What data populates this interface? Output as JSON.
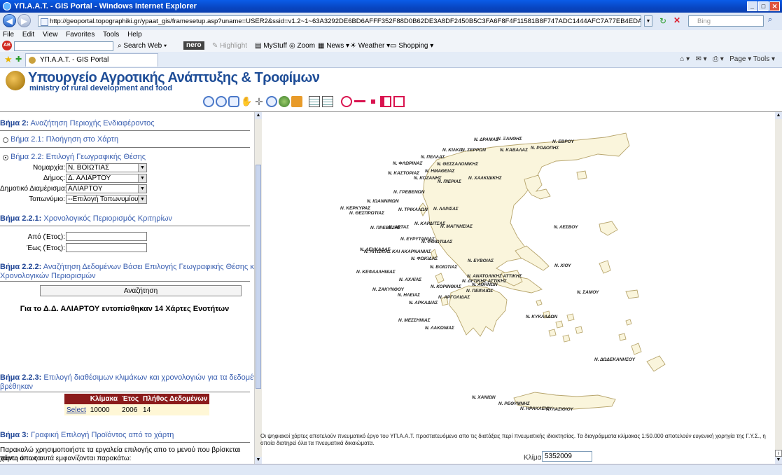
{
  "window": {
    "title": "ΥΠ.Α.Α.Τ. - GIS Portal - Windows Internet Explorer"
  },
  "browser": {
    "url": "http://geoportal.topographiki.gr/ypaat_gis/framesetup.asp?uname=USER2&ssid=v1.2~1~63A3292DE6BD6AFFF352F88D0B62DE3A8DF2450B5C3FA6F8F4F11581B8F747ADC1444AFC7A77EB4EDA496CCD72E9D7766FE09210B8BC1168C0B4AFD91005430F8F46",
    "search_engine": "Bing",
    "menu": [
      "File",
      "Edit",
      "View",
      "Favorites",
      "Tools",
      "Help"
    ],
    "toolbar": {
      "search_web": "Search Web",
      "nero": "nero",
      "highlight": "Highlight",
      "mystuff": "MyStuff",
      "zoom": "Zoom",
      "news": "News",
      "weather": "Weather",
      "shopping": "Shopping"
    },
    "tab_label": "ΥΠ.Α.Α.Τ. - GIS Portal",
    "right_tools": "Page ▾   Tools ▾"
  },
  "header": {
    "title": "Υπουργείο Αγροτικής Ανάπτυξης & Τροφίμων",
    "subtitle": "ministry of rural development and food"
  },
  "left": {
    "step2": {
      "prefix": "Βήμα 2:",
      "text": "Αναζήτηση Περιοχής Ενδιαφέροντος"
    },
    "step21": "Βήμα 2.1: Πλοήγηση στο Χάρτη",
    "step22": "Βήμα 2.2: Επιλογή Γεωγραφικής Θέσης",
    "fields": {
      "nomarchia_label": "Νομαρχία:",
      "nomarchia_value": "Ν. ΒΟΙΩΤΙΑΣ",
      "dimos_label": "Δήμος:",
      "dimos_value": "Δ. ΑΛΙΑΡΤΟΥ",
      "dd_label": "Δημοτικό Διαμέρισμα:",
      "dd_value": "ΑΛΙΑΡΤΟΥ",
      "toponymio_label": "Τοπωνύμιο:",
      "toponymio_value": "--Επιλογή Τοπωνυμίου--"
    },
    "step221": {
      "prefix": "Βήμα 2.2.1:",
      "text": "Χρονολογικός Περιορισμός Κριτηρίων"
    },
    "from_label": "Από (Έτος):",
    "to_label": "Έως (Έτος):",
    "step222": {
      "prefix": "Βήμα 2.2.2:",
      "text1": "Αναζήτηση Δεδομένων Βάσει Επιλογής Γεωγραφικής Θέσης και",
      "text2": "Χρονολογικών Περιορισμών"
    },
    "search_button": "Αναζήτηση",
    "found_message": "Για το Δ.Δ. ΑΛΙΑΡΤΟΥ εντοπίσθηκαν 14 Χάρτες Ενοτήτων",
    "step223": {
      "prefix": "Βήμα 2.2.3:",
      "text1": "Επιλογή διαθέσιμων κλιμάκων και χρονολογιών για τα δεδομένα που",
      "text2": "βρέθηκαν"
    },
    "table": {
      "headers": [
        "Κλίμακα",
        "Έτος",
        "Πλήθος Δεδομένων"
      ],
      "rows": [
        {
          "action": "Select",
          "scale": "10000",
          "year": "2006",
          "count": "14"
        }
      ]
    },
    "step3": {
      "prefix": "Βήμα 3:",
      "text": "Γραφική Επιλογή Προϊόντος από το χάρτη"
    },
    "step3_text1": "Παρακαλώ χρησιμοποιήστε τα εργαλεία επιλογής απο το μενού που βρίσκεται πάνω απο το",
    "step3_text2": "χάρτη όπως αυτά εμφανίζονται παρακάτω:"
  },
  "map": {
    "labels": {
      "drama": "Ν. ΔΡΑΜΑΣ",
      "xanthi": "Ν. ΞΑΝΘΗΣ",
      "evros": "Ν. ΕΒΡΟΥ",
      "rodopi": "Ν. ΡΟΔΟΠΗΣ",
      "kilkis": "Ν. ΚΙΛΚΙΣ",
      "serres": "Ν. ΣΕΡΡΩΝ",
      "kavala": "Ν. ΚΑΒΑΛΑΣ",
      "pella": "Ν. ΠΕΛΛΑΣ",
      "florina": "Ν. ΦΛΩΡΙΝΑΣ",
      "thessaloniki": "Ν. ΘΕΣΣΑΛΟΝΙΚΗΣ",
      "imathia": "Ν. ΗΜΑΘΕΙΑΣ",
      "kastoria": "Ν. ΚΑΣΤΟΡΙΑΣ",
      "kozani": "Ν. ΚΟΖΑΝΗΣ",
      "pieria": "Ν. ΠΙΕΡΙΑΣ",
      "chalkidiki": "Ν. ΧΑΛΚΙΔΙΚΗΣ",
      "grevena": "Ν. ΓΡΕΒΕΝΩΝ",
      "ioannina": "Ν. ΙΩΑΝΝΙΝΩΝ",
      "kerkyra": "Ν. ΚΕΡΚΥΡΑΣ",
      "thesprotia": "Ν. ΘΕΣΠΡΩΤΙΑΣ",
      "trikala": "Ν. ΤΡΙΚΑΛΩΝ",
      "larisa": "Ν. ΛΑΡΙΣΑΣ",
      "preveza": "Ν. ΠΡΕΒΕΖΗΣ",
      "arta": "Ν. ΑΡΤΑΣ",
      "karditsa": "Ν. ΚΑΡΔΙΤΣΑΣ",
      "magnisia": "Ν. ΜΑΓΝΗΣΙΑΣ",
      "lesvos": "Ν. ΛΕΣΒΟΥ",
      "evrytania": "Ν. ΕΥΡΥΤΑΝΙΑΣ",
      "fthiotida": "Ν. ΦΘΙΩΤΙΔΑΣ",
      "lefkada": "Ν. ΛΕΥΚΑΔΑΣ",
      "aitoloakarnania": "Ν. ΑΙΤΩΛΙΑΣ ΚΑΙ ΑΚΑΡΝΑΝΙΑΣ",
      "fokida": "Ν. ΦΩΚΙΔΑΣ",
      "evvoia": "Ν. ΕΥΒΟΙΑΣ",
      "chios": "Ν. ΧΙΟΥ",
      "kefallinia": "Ν. ΚΕΦΑΛΛΗΝΙΑΣ",
      "voiotia": "Ν. ΒΟΙΩΤΙΑΣ",
      "anatoliki_attiki": "Ν. ΑΝΑΤΟΛΙΚΗΣ ΑΤΤΙΚΗΣ",
      "dytiki_attiki": "Ν. ΔΥΤΙΚΗΣ ΑΤΤΙΚΗΣ",
      "athinon": "Ν. ΑΘΗΝΩΝ",
      "achaia": "Ν. ΑΧΑΪΑΣ",
      "korinthia": "Ν. ΚΟΡΙΝΘΙΑΣ",
      "zakynthos": "Ν. ΖΑΚΥΝΘΟΥ",
      "ileia": "Ν. ΗΛΕΙΑΣ",
      "peiraias": "Ν. ΠΕΙΡΑΙΩΣ",
      "samos": "Ν. ΣΑΜΟΥ",
      "argolida": "Ν. ΑΡΓΟΛΙΔΑΣ",
      "arkadia": "Ν. ΑΡΚΑΔΙΑΣ",
      "messinia": "Ν. ΜΕΣΣΗΝΙΑΣ",
      "lakonia": "Ν. ΛΑΚΩΝΙΑΣ",
      "kyklades": "Ν. ΚΥΚΛΑΔΩΝ",
      "dodekanisa": "Ν. ΔΩΔΕΚΑΝΗΣΟΥ",
      "chania": "Ν. ΧΑΝΙΩΝ",
      "rethymno": "Ν. ΡΕΘΥΜΝΗΣ",
      "irakleio": "Ν. ΗΡΑΚΛΕΙΟΥ",
      "lasithi": "Ν. ΛΑΣΙΘΙΟΥ"
    },
    "copyright": "Οι ψηφιακοί χάρτες αποτελούν πνευματικό έργο του ΥΠ.Α.Α.Τ. προστατευόμενο απο τις διατάξεις περί πνευματικής ιδιοκτησίας. Τα διαγράμματα κλίμακας 1:50.000 αποτελούν ευγενική χορηγία της Γ.Υ.Σ., η οποία διατηρεί όλα τα πνευματικά δικαιώματα.",
    "scale_label": "Κλίμακα 1:",
    "scale_value": "5352009"
  },
  "colors": {
    "land": "#faf5dc",
    "border": "#b7a56d",
    "heading": "#1f4596",
    "table_header": "#8b1b1b"
  }
}
